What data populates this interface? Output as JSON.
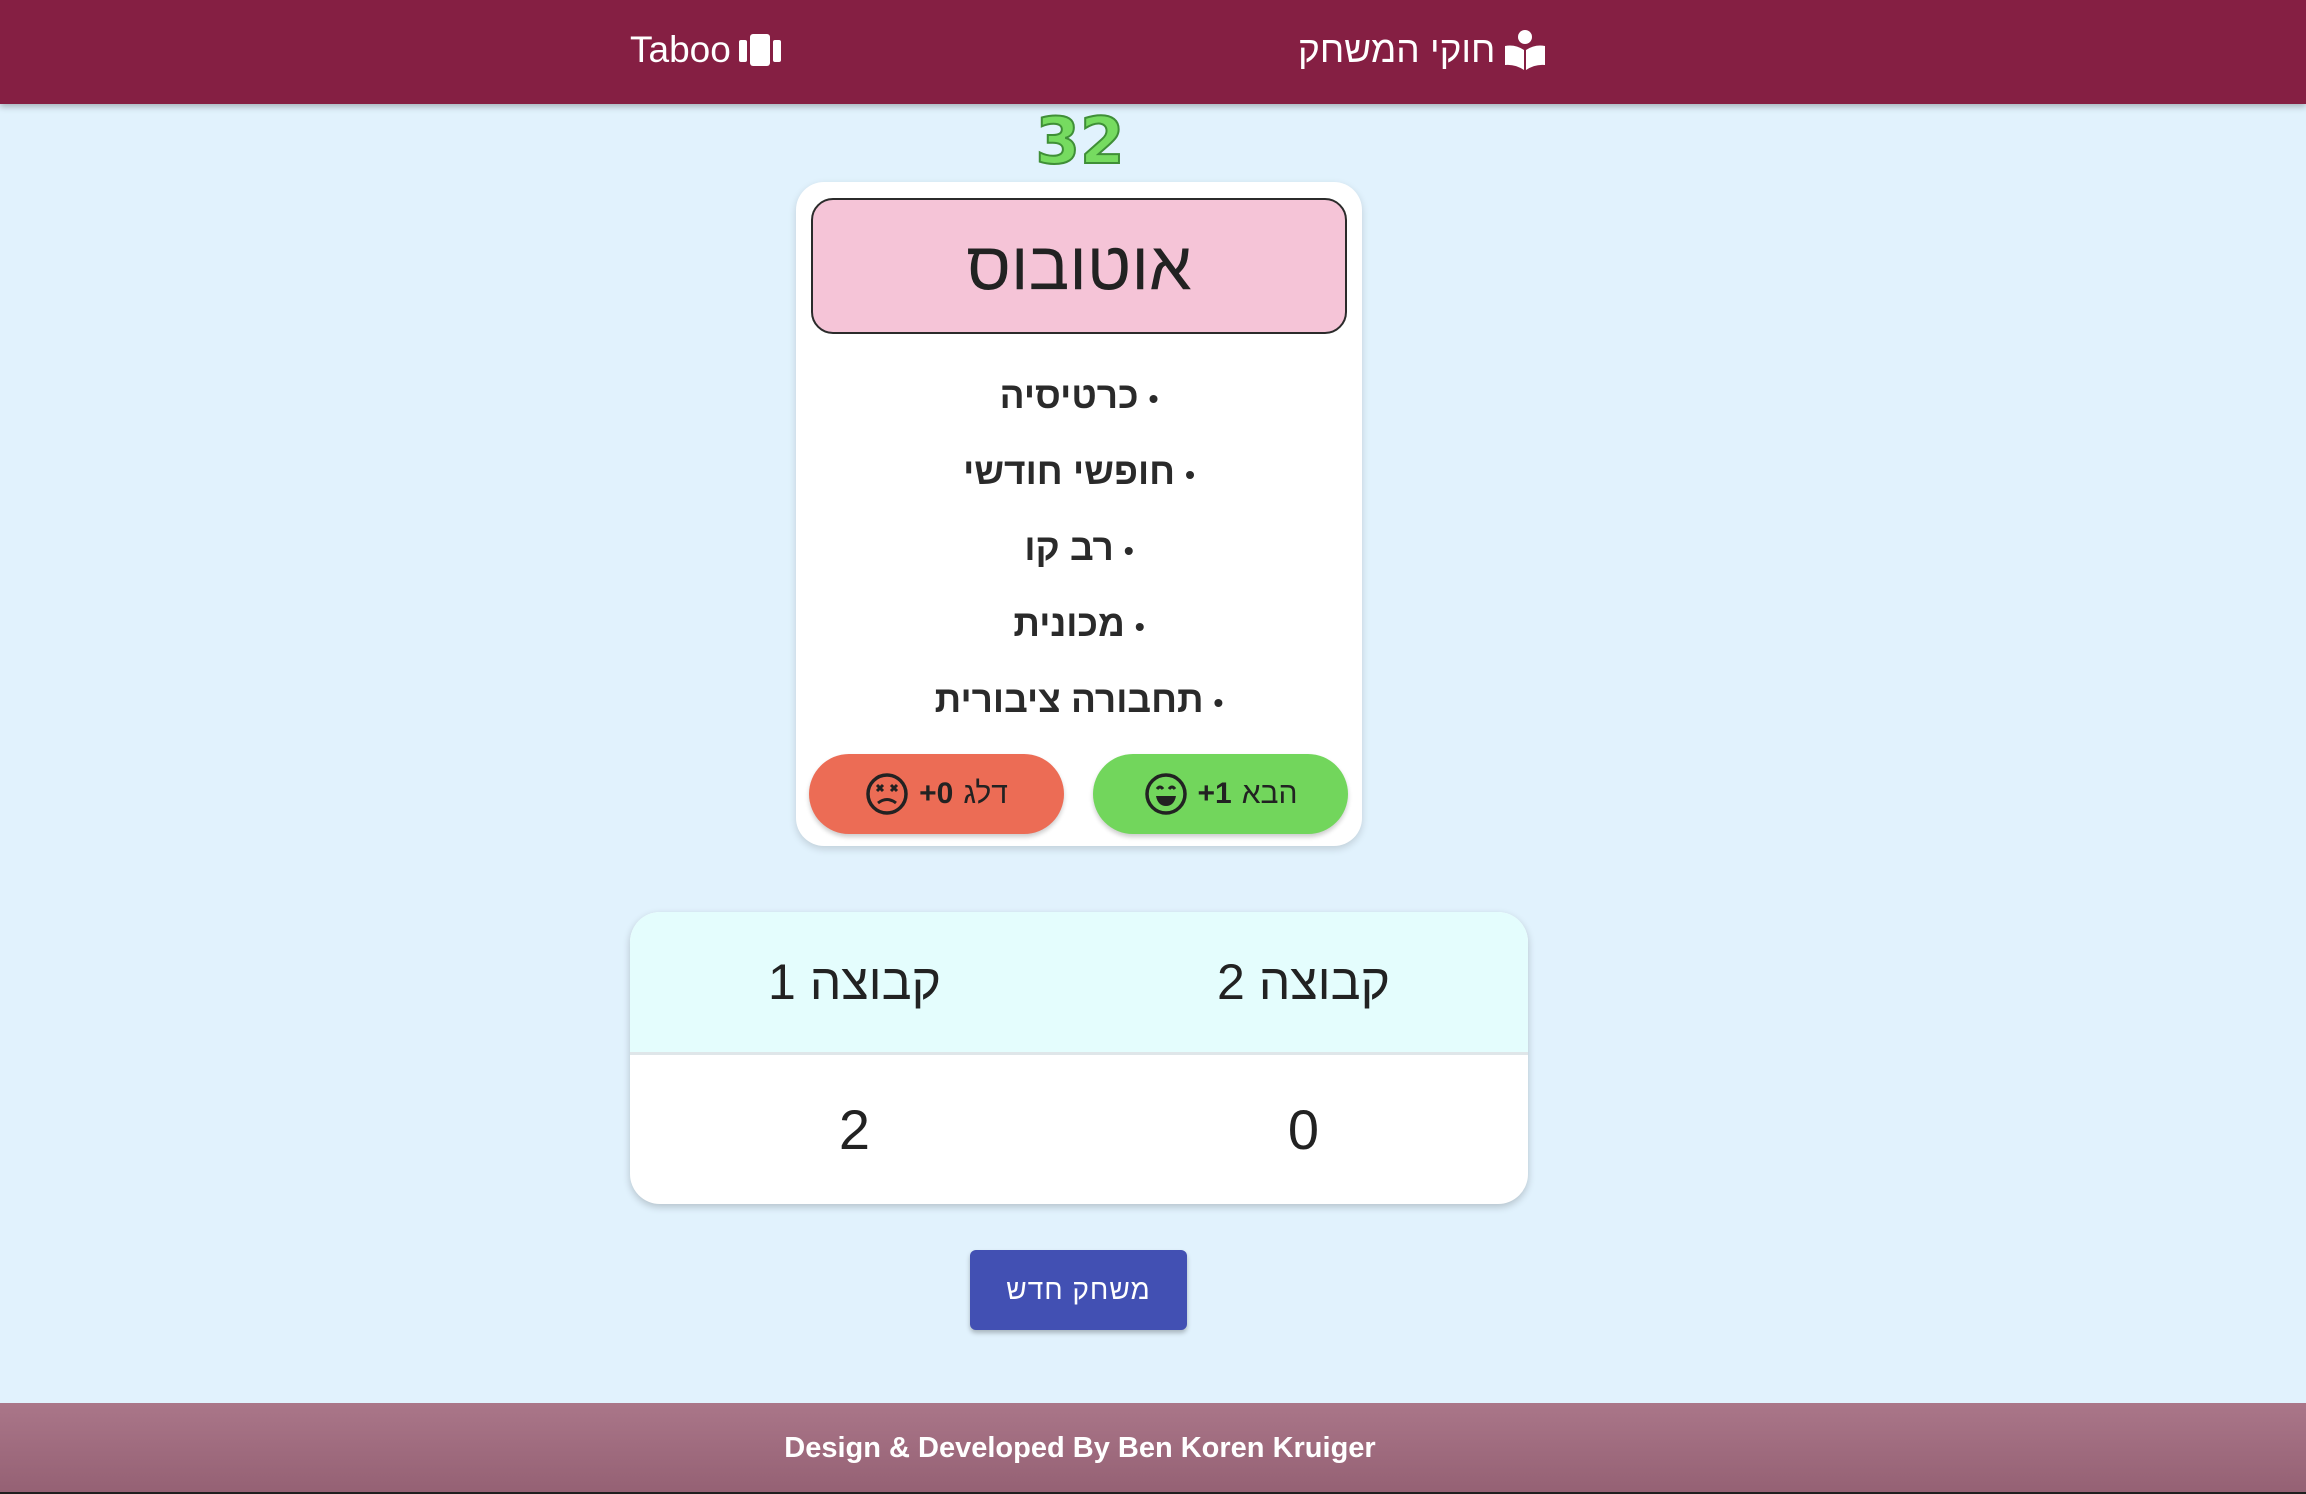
{
  "nav": {
    "brand": "Taboo",
    "rules": "חוקי המשחק",
    "brand_icon": "cards-icon",
    "rules_icon": "book-reader-icon"
  },
  "timer": "32",
  "card": {
    "word": "אוטובוס",
    "taboo_words": [
      "כרטיסיה",
      "חופשי חודשי",
      "רב קו",
      "מכונית",
      "תחבורה ציבורית"
    ],
    "next_label": "הבא",
    "next_points": "+1",
    "skip_label": "דלג",
    "skip_points": "+0"
  },
  "scores": {
    "headers": [
      "קבוצה 1",
      "קבוצה 2"
    ],
    "values": [
      "2",
      "0"
    ]
  },
  "new_game_label": "משחק חדש",
  "footer": "Design & Developed By Ben Koren Kruiger",
  "colors": {
    "navbar": "#851f43",
    "background": "#e1f2fd",
    "word_box": "#f5c4d7",
    "next_button": "#72d65c",
    "skip_button": "#ec6c55",
    "new_game_button": "#4250b3",
    "timer": "#76db60"
  }
}
